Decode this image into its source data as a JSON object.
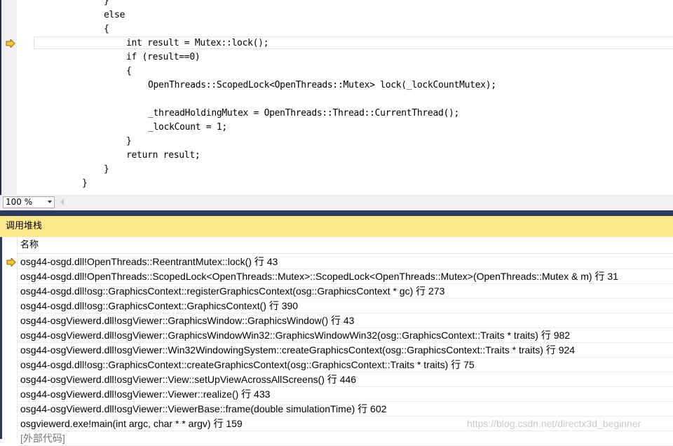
{
  "editor": {
    "code_lines": [
      "}",
      "else",
      "{",
      "int result = Mutex::lock();",
      "if (result==0)",
      "{",
      "OpenThreads::ScopedLock<OpenThreads::Mutex> lock(_lockCountMutex);",
      "_threadHoldingMutex = OpenThreads::Thread::CurrentThread();",
      "_lockCount = 1;",
      "}",
      "return result;",
      "}",
      "}"
    ]
  },
  "zoom": {
    "value": "100 %"
  },
  "call_stack": {
    "title": "调用堆栈",
    "column_header": "名称",
    "rows": [
      "osg44-osgd.dll!OpenThreads::ReentrantMutex::lock() 行 43",
      "osg44-osgd.dll!OpenThreads::ScopedLock<OpenThreads::Mutex>::ScopedLock<OpenThreads::Mutex>(OpenThreads::Mutex & m) 行 31",
      "osg44-osgd.dll!osg::GraphicsContext::registerGraphicsContext(osg::GraphicsContext * gc) 行 273",
      "osg44-osgd.dll!osg::GraphicsContext::GraphicsContext() 行 390",
      "osg44-osgViewerd.dll!osgViewer::GraphicsWindow::GraphicsWindow() 行 43",
      "osg44-osgViewerd.dll!osgViewer::GraphicsWindowWin32::GraphicsWindowWin32(osg::GraphicsContext::Traits * traits) 行 982",
      "osg44-osgViewerd.dll!osgViewer::Win32WindowingSystem::createGraphicsContext(osg::GraphicsContext::Traits * traits) 行 924",
      "osg44-osgd.dll!osg::GraphicsContext::createGraphicsContext(osg::GraphicsContext::Traits * traits) 行 75",
      "osg44-osgViewerd.dll!osgViewer::View::setUpViewAcrossAllScreens() 行 446",
      "osg44-osgViewerd.dll!osgViewer::Viewer::realize() 行 433",
      "osg44-osgViewerd.dll!osgViewer::ViewerBase::frame(double simulationTime) 行 602",
      "osgviewerd.exe!main(int argc, char * * argv) 行 159",
      "[外部代码]"
    ]
  },
  "watermark": "https://blog.csdn.net/directx3d_beginner",
  "colors": {
    "panel_title_bg": "#ffe98f",
    "current_statement_arrow": "#f5c542",
    "splitter": "#2d3b5c"
  },
  "icons": {
    "editor_current_line": "current-statement-arrow-icon",
    "call_stack_current_frame": "current-frame-arrow-icon"
  }
}
